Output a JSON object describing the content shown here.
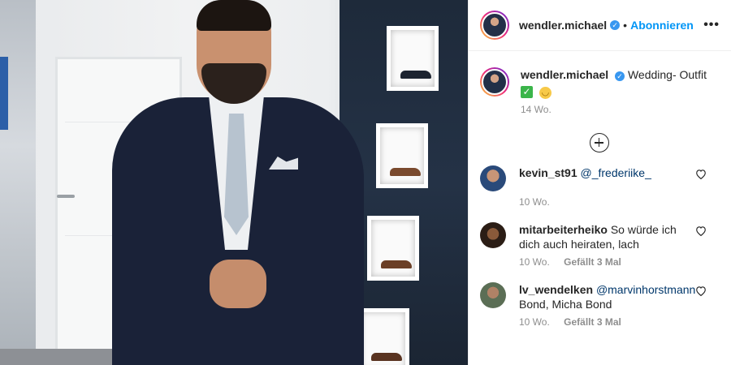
{
  "post": {
    "username": "wendler.michael",
    "follow_label": "Abonnieren",
    "dot": "•",
    "more_label": "•••"
  },
  "caption": {
    "username": "wendler.michael",
    "text": "Wedding- Outfit",
    "time": "14 Wo."
  },
  "comments": [
    {
      "username": "kevin_st91",
      "mention": "@_frederiike_",
      "text": "",
      "time": "10 Wo.",
      "likes": ""
    },
    {
      "username": "mitarbeiterheiko",
      "mention": "",
      "text": "So würde ich dich auch heiraten, lach",
      "time": "10 Wo.",
      "likes": "Gefällt 3 Mal"
    },
    {
      "username": "lv_wendelken",
      "mention": "@marvinhorstmann",
      "text": "Bond, Micha Bond",
      "time": "10 Wo.",
      "likes": "Gefällt 3 Mal"
    }
  ],
  "icons": {
    "verified": "verified-badge-icon",
    "heart": "heart-icon",
    "plus": "plus-circle-icon",
    "more": "more-options-icon"
  },
  "colors": {
    "accent": "#0095f6",
    "verified": "#3897f0",
    "mention": "#00376b",
    "meta": "#8e8e8e"
  }
}
